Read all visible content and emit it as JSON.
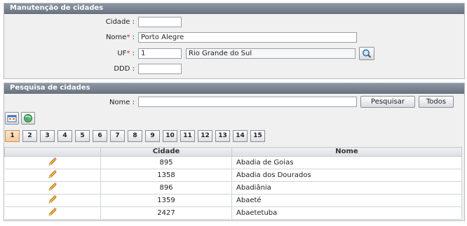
{
  "manutencao": {
    "title": "Manutenção de cidades",
    "cidade_label": "Cidade :",
    "cidade_value": "",
    "nome_label": "Nome",
    "nome_req": "*",
    "nome_sep": ":",
    "nome_value": "Porto Alegre",
    "uf_label": "UF",
    "uf_req": "*",
    "uf_sep": ":",
    "uf_code": "1",
    "uf_name": "Rio Grande do Sul",
    "ddd_label": "DDD :",
    "ddd_value": ""
  },
  "pesquisa": {
    "title": "Pesquisa de cidades",
    "nome_label": "Nome :",
    "nome_value": "",
    "pesquisar_label": "Pesquisar",
    "todos_label": "Todos"
  },
  "pagination": {
    "pages": [
      "1",
      "2",
      "3",
      "4",
      "5",
      "6",
      "7",
      "8",
      "9",
      "10",
      "11",
      "12",
      "13",
      "14",
      "15"
    ],
    "active": "1"
  },
  "table": {
    "headers": {
      "edit": "",
      "cidade": "Cidade",
      "nome": "Nome"
    },
    "rows": [
      {
        "codigo": "895",
        "nome": "Abadia de Goias"
      },
      {
        "codigo": "1358",
        "nome": "Abadia dos Dourados"
      },
      {
        "codigo": "896",
        "nome": "Abadiânia"
      },
      {
        "codigo": "1359",
        "nome": "Abaeté"
      },
      {
        "codigo": "2427",
        "nome": "Abaetetuba"
      }
    ]
  },
  "icons": {
    "search": "magnifier-icon",
    "new": "new-record-icon",
    "refresh": "refresh-globe-icon",
    "edit": "pencil-icon"
  }
}
